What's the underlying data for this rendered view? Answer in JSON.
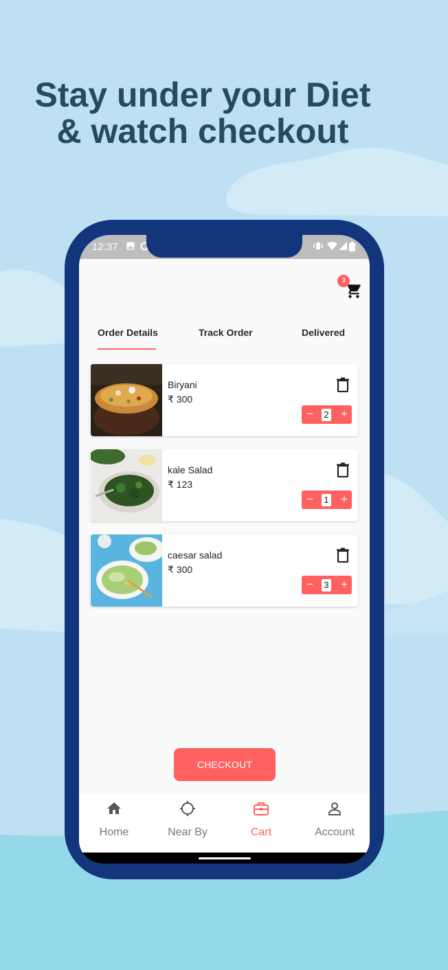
{
  "headline": {
    "line1": "Stay under your Diet",
    "line2": "& watch checkout"
  },
  "status_bar": {
    "time": "12:37"
  },
  "cart": {
    "badge_count": "3"
  },
  "tabs": [
    {
      "label": "Order Details",
      "active": true
    },
    {
      "label": "Track Order",
      "active": false
    },
    {
      "label": "Delivered",
      "active": false
    }
  ],
  "items": [
    {
      "name": "Biryani",
      "price": "₹ 300",
      "quantity": "2",
      "image": "biryani-photo"
    },
    {
      "name": "kale Salad",
      "price": "₹ 123",
      "quantity": "1",
      "image": "kale-salad-photo"
    },
    {
      "name": "caesar salad",
      "price": "₹ 300",
      "quantity": "3",
      "image": "caesar-salad-photo"
    }
  ],
  "stepper": {
    "minus": "−",
    "plus": "+"
  },
  "checkout_label": "CHECKOUT",
  "bottom_nav": [
    {
      "label": "Home",
      "icon": "home-icon",
      "active": false
    },
    {
      "label": "Near By",
      "icon": "location-target-icon",
      "active": false
    },
    {
      "label": "Cart",
      "icon": "briefcase-cart-icon",
      "active": true
    },
    {
      "label": "Account",
      "icon": "person-icon",
      "active": false
    }
  ],
  "colors": {
    "accent": "#ff6161",
    "phone_frame": "#12357c",
    "headline": "#264a60",
    "background": "#bde0f3"
  }
}
